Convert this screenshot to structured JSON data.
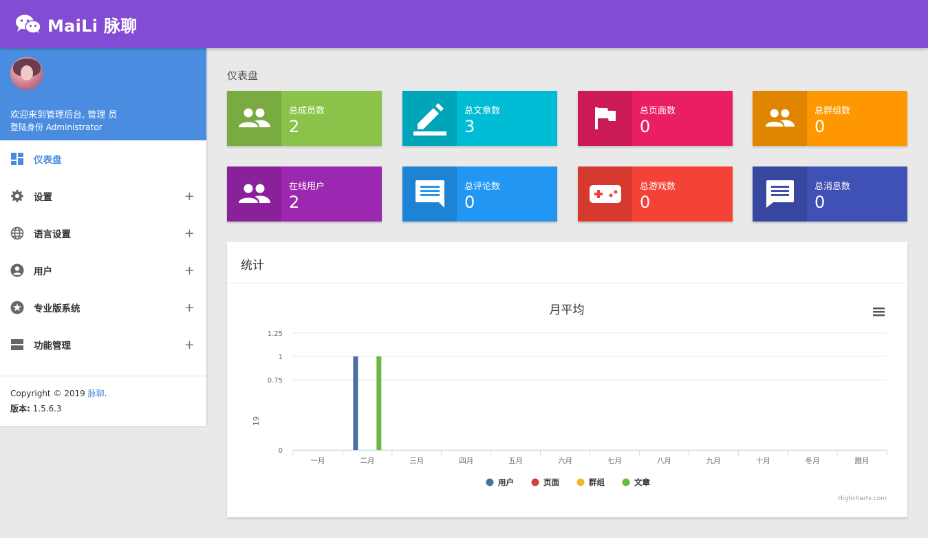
{
  "header": {
    "brand": "MaiLi 脉聊",
    "logo_icon": "wechat-icon"
  },
  "user": {
    "welcome": "欢迎来到管理后台, 管理 员",
    "role": "登陆身份 Administrator"
  },
  "sidebar": {
    "items": [
      {
        "label": "仪表盘",
        "icon": "dashboard-icon",
        "active": true
      },
      {
        "label": "设置",
        "icon": "gear-icon",
        "expandable": "+"
      },
      {
        "label": "语言设置",
        "icon": "globe-icon",
        "expandable": "+"
      },
      {
        "label": "用户",
        "icon": "user-circle-icon",
        "expandable": "+"
      },
      {
        "label": "专业版系统",
        "icon": "star-icon",
        "expandable": "+"
      },
      {
        "label": "功能管理",
        "icon": "panel-icon",
        "expandable": "+"
      }
    ],
    "footer": {
      "copyright_prefix": "Copyright © 2019 ",
      "copyright_link": "脉聊",
      "copyright_suffix": ".",
      "version_label": "版本:",
      "version_value": " 1.5.6.3"
    }
  },
  "page": {
    "title": "仪表盘"
  },
  "stats": [
    {
      "label": "总成员数",
      "value": "2",
      "color": "#8bc34a",
      "icon": "group-icon"
    },
    {
      "label": "总文章数",
      "value": "3",
      "color": "#00bcd4",
      "icon": "pencil-icon"
    },
    {
      "label": "总页面数",
      "value": "0",
      "color": "#e91e63",
      "icon": "flag-icon"
    },
    {
      "label": "总群组数",
      "value": "0",
      "color": "#ff9800",
      "icon": "group-icon"
    },
    {
      "label": "在线用户",
      "value": "2",
      "color": "#9c27b0",
      "icon": "group-icon"
    },
    {
      "label": "总评论数",
      "value": "0",
      "color": "#2196f3",
      "icon": "comment-icon"
    },
    {
      "label": "总游戏数",
      "value": "0",
      "color": "#f44336",
      "icon": "gamepad-icon"
    },
    {
      "label": "总消息数",
      "value": "0",
      "color": "#3f51b5",
      "icon": "message-icon"
    }
  ],
  "panel": {
    "title": "统计"
  },
  "chart_data": {
    "type": "bar",
    "title": "月平均",
    "ylabel": "19",
    "categories": [
      "一月",
      "二月",
      "三月",
      "四月",
      "五月",
      "六月",
      "七月",
      "八月",
      "九月",
      "十月",
      "冬月",
      "腊月"
    ],
    "yticks": [
      "0",
      "0.75",
      "1",
      "1.25"
    ],
    "series": [
      {
        "name": "用户",
        "color": "#4a6fa5",
        "values": [
          0,
          1,
          0,
          0,
          0,
          0,
          0,
          0,
          0,
          0,
          0,
          0
        ]
      },
      {
        "name": "页面",
        "color": "#d33f3f",
        "values": [
          0,
          0,
          0,
          0,
          0,
          0,
          0,
          0,
          0,
          0,
          0,
          0
        ]
      },
      {
        "name": "群组",
        "color": "#f3b72b",
        "values": [
          0,
          0,
          0,
          0,
          0,
          0,
          0,
          0,
          0,
          0,
          0,
          0
        ]
      },
      {
        "name": "文章",
        "color": "#6bb843",
        "values": [
          0,
          1,
          0,
          0,
          0,
          0,
          0,
          0,
          0,
          0,
          0,
          0
        ]
      }
    ],
    "credits": "Highcharts.com",
    "menu_icon": "hamburger-menu-icon",
    "legend_position": "bottom-center",
    "grid": true
  }
}
